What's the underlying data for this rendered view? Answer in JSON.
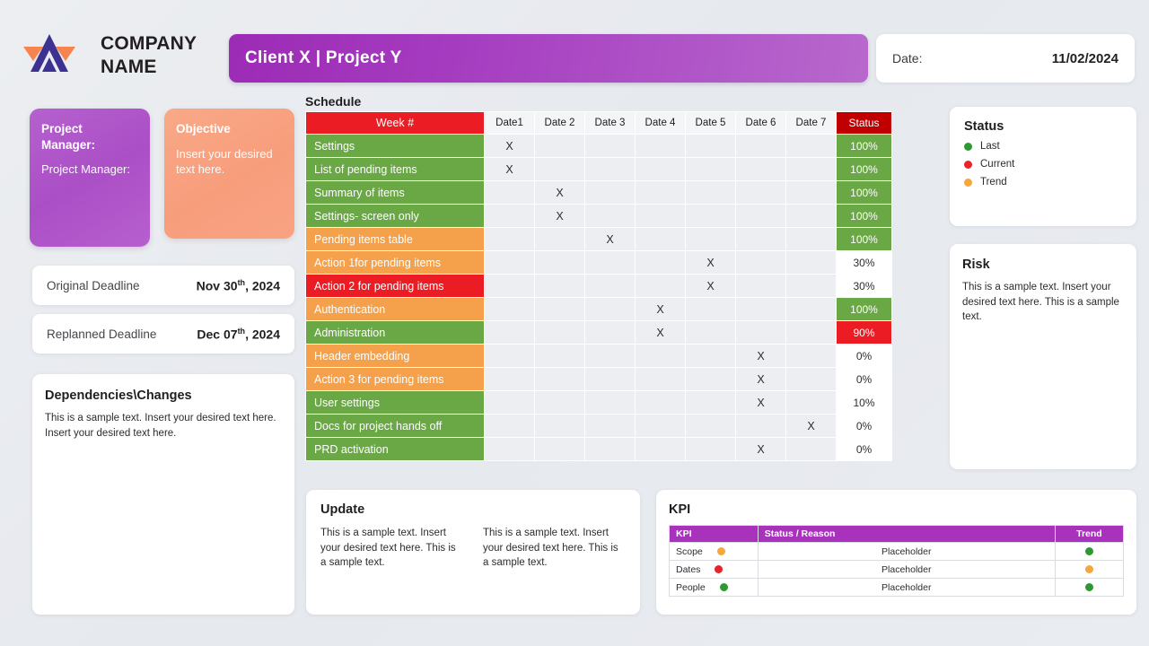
{
  "header": {
    "company_name": "COMPANY NAME",
    "logo_icon": "company-logo-icon",
    "project_title": "Client X | Project  Y",
    "date_label": "Date:",
    "date_value": "11/02/2024",
    "accent_purple": "#a932bd",
    "accent_orange": "#f79d7c"
  },
  "project_manager": {
    "heading": "Project Manager:",
    "value": "Project Manager:"
  },
  "objective": {
    "heading": "Objective",
    "body": "Insert your desired text here."
  },
  "deadlines": [
    {
      "label": "Original Deadline",
      "month": "Nov",
      "day": "30",
      "suffix": "th",
      "year": ", 2024"
    },
    {
      "label": "Replanned Deadline",
      "month": "Dec",
      "day": "07",
      "suffix": "th",
      "year": ", 2024"
    }
  ],
  "dependencies": {
    "title": "Dependencies\\Changes",
    "body": "This is a sample text. Insert your desired  text here. Insert your desired text here."
  },
  "schedule": {
    "title": "Schedule",
    "columns": [
      "Week #",
      "Date1",
      "Date 2",
      "Date 3",
      "Date 4",
      "Date 5",
      "Date 6",
      "Date 7",
      "Status"
    ],
    "rows": [
      {
        "task": "Settings",
        "color": "green",
        "marks": [
          1,
          0,
          0,
          0,
          0,
          0,
          0
        ],
        "status": "100%",
        "status_color": "green"
      },
      {
        "task": "List of pending items",
        "color": "green",
        "marks": [
          1,
          0,
          0,
          0,
          0,
          0,
          0
        ],
        "status": "100%",
        "status_color": "green"
      },
      {
        "task": "Summary of items",
        "color": "green",
        "marks": [
          0,
          1,
          0,
          0,
          0,
          0,
          0
        ],
        "status": "100%",
        "status_color": "green"
      },
      {
        "task": "Settings- screen only",
        "color": "green",
        "marks": [
          0,
          1,
          0,
          0,
          0,
          0,
          0
        ],
        "status": "100%",
        "status_color": "green"
      },
      {
        "task": "Pending items table",
        "color": "orange",
        "marks": [
          0,
          0,
          1,
          0,
          0,
          0,
          0
        ],
        "status": "100%",
        "status_color": "green"
      },
      {
        "task": "Action 1for pending items",
        "color": "orange",
        "marks": [
          0,
          0,
          0,
          0,
          1,
          0,
          0
        ],
        "status": "30%",
        "status_color": "white"
      },
      {
        "task": "Action 2 for pending items",
        "color": "red",
        "marks": [
          0,
          0,
          0,
          0,
          1,
          0,
          0
        ],
        "status": "30%",
        "status_color": "white"
      },
      {
        "task": "Authentication",
        "color": "orange",
        "marks": [
          0,
          0,
          0,
          1,
          0,
          0,
          0
        ],
        "status": "100%",
        "status_color": "green"
      },
      {
        "task": "Administration",
        "color": "green",
        "marks": [
          0,
          0,
          0,
          1,
          0,
          0,
          0
        ],
        "status": "90%",
        "status_color": "red"
      },
      {
        "task": "Header embedding",
        "color": "orange",
        "marks": [
          0,
          0,
          0,
          0,
          0,
          1,
          0
        ],
        "status": "0%",
        "status_color": "white"
      },
      {
        "task": "Action 3 for pending items",
        "color": "orange",
        "marks": [
          0,
          0,
          0,
          0,
          0,
          1,
          0
        ],
        "status": "0%",
        "status_color": "white"
      },
      {
        "task": "User settings",
        "color": "green",
        "marks": [
          0,
          0,
          0,
          0,
          0,
          1,
          0
        ],
        "status": "10%",
        "status_color": "white"
      },
      {
        "task": "Docs for project hands off",
        "color": "green",
        "marks": [
          0,
          0,
          0,
          0,
          0,
          0,
          1
        ],
        "status": "0%",
        "status_color": "white"
      },
      {
        "task": "PRD activation",
        "color": "green",
        "marks": [
          0,
          0,
          0,
          0,
          0,
          1,
          0
        ],
        "status": "0%",
        "status_color": "white"
      }
    ],
    "mark_symbol": "X"
  },
  "status_legend": {
    "title": "Status",
    "items": [
      {
        "label": "Last",
        "color": "#2e9930"
      },
      {
        "label": "Current",
        "color": "#e8232a"
      },
      {
        "label": "Trend",
        "color": "#f5a63c"
      }
    ]
  },
  "risk": {
    "title": "Risk",
    "body": "This is a sample text. Insert your desired text here. This is a sample text."
  },
  "update": {
    "title": "Update",
    "columns": [
      "This is a sample text. Insert your desired text here. This is a sample text.",
      "This is a sample text. Insert your desired text here. This is a sample text."
    ]
  },
  "kpi": {
    "title": "KPI",
    "columns": [
      "KPI",
      "Status / Reason",
      "Trend"
    ],
    "rows": [
      {
        "name": "Scope",
        "status_color": "#f5a63c",
        "reason": "Placeholder",
        "trend_color": "#2e9930"
      },
      {
        "name": "Dates",
        "status_color": "#e8232a",
        "reason": "Placeholder",
        "trend_color": "#f5a63c"
      },
      {
        "name": "People",
        "status_color": "#2e9930",
        "reason": "Placeholder",
        "trend_color": "#2e9930"
      }
    ]
  }
}
